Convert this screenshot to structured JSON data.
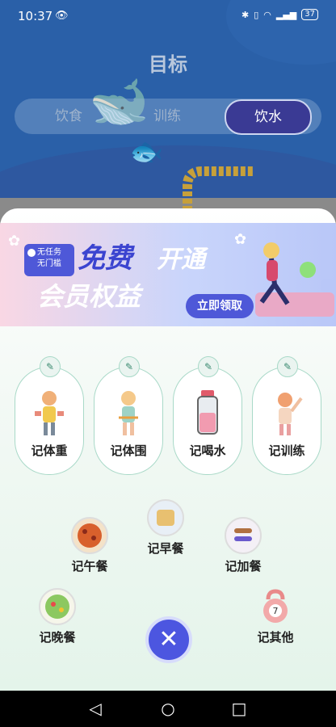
{
  "status": {
    "time": "10:37",
    "battery": "37"
  },
  "page": {
    "title": "目标"
  },
  "tabs": [
    {
      "label": "饮食"
    },
    {
      "label": "训练"
    },
    {
      "label": "饮水",
      "active": true
    }
  ],
  "banner": {
    "tag_line1": "无任务",
    "tag_line2": "无门槛",
    "free": "免费",
    "open": "开通",
    "rights": "会员权益",
    "button": "立即领取"
  },
  "records": [
    {
      "label": "记体重",
      "icon": "dumbbell-girl-icon"
    },
    {
      "label": "记体围",
      "icon": "tape-measure-girl-icon"
    },
    {
      "label": "记喝水",
      "icon": "water-bottle-icon"
    },
    {
      "label": "记训练",
      "icon": "training-girl-icon"
    }
  ],
  "meals": {
    "breakfast": "记早餐",
    "lunch": "记午餐",
    "snack": "记加餐",
    "dinner": "记晚餐",
    "other": "记其他",
    "kettlebell_number": "7"
  },
  "colors": {
    "accent": "#4c56e0",
    "card_border": "#a9d9c8",
    "top_bg": "#2a60a8"
  }
}
